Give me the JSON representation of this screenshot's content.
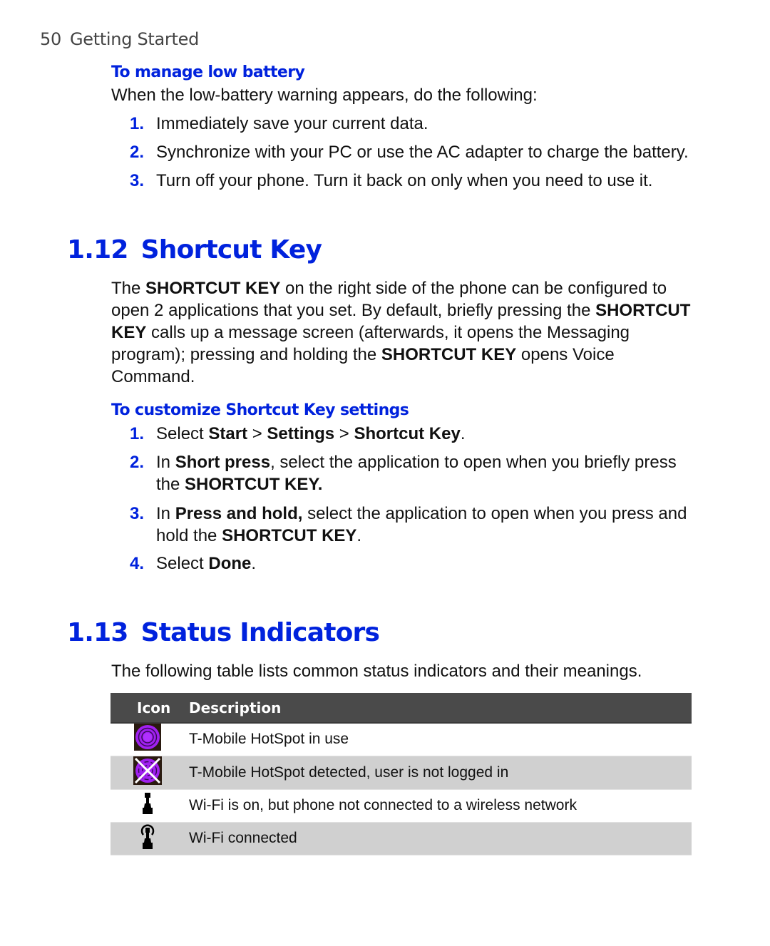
{
  "running_head": {
    "page_number": "50",
    "chapter": "Getting Started"
  },
  "low_battery": {
    "heading": "To manage low battery",
    "intro": "When the low-battery warning appears, do the following:",
    "steps": [
      {
        "num": "1.",
        "text": "Immediately save your current data."
      },
      {
        "num": "2.",
        "text": "Synchronize with your PC or use the AC adapter to charge the battery."
      },
      {
        "num": "3.",
        "text": "Turn off your phone. Turn it back on only when you need to use it."
      }
    ]
  },
  "section_112": {
    "number": "1.12",
    "title": "Shortcut Key",
    "paragraph": [
      {
        "t": "The ",
        "b": false
      },
      {
        "t": "SHORTCUT KEY",
        "b": true
      },
      {
        "t": " on the right side of the phone can be configured to open 2 applications that you set. By default, briefly pressing the ",
        "b": false
      },
      {
        "t": "SHORTCUT KEY",
        "b": true
      },
      {
        "t": " calls up a message screen (afterwards, it opens the Messaging program); pressing and holding the ",
        "b": false
      },
      {
        "t": "SHORTCUT KEY",
        "b": true
      },
      {
        "t": " opens Voice Command.",
        "b": false
      }
    ],
    "sub_heading": "To customize Shortcut Key settings",
    "steps": [
      {
        "num": "1.",
        "parts": [
          {
            "t": "Select ",
            "b": false
          },
          {
            "t": "Start",
            "b": true
          },
          {
            "t": " > ",
            "b": false
          },
          {
            "t": "Settings",
            "b": true
          },
          {
            "t": " > ",
            "b": false
          },
          {
            "t": "Shortcut Key",
            "b": true
          },
          {
            "t": ".",
            "b": false
          }
        ]
      },
      {
        "num": "2.",
        "parts": [
          {
            "t": "In ",
            "b": false
          },
          {
            "t": "Short press",
            "b": true
          },
          {
            "t": ", select the application to open when you briefly press the ",
            "b": false
          },
          {
            "t": "SHORTCUT KEY.",
            "b": true
          }
        ]
      },
      {
        "num": "3.",
        "parts": [
          {
            "t": "In ",
            "b": false
          },
          {
            "t": "Press and hold,",
            "b": true
          },
          {
            "t": " select the application to open when you press and hold the ",
            "b": false
          },
          {
            "t": "SHORTCUT KEY",
            "b": true
          },
          {
            "t": ".",
            "b": false
          }
        ]
      },
      {
        "num": "4.",
        "parts": [
          {
            "t": "Select ",
            "b": false
          },
          {
            "t": "Done",
            "b": true
          },
          {
            "t": ".",
            "b": false
          }
        ]
      }
    ]
  },
  "section_113": {
    "number": "1.13",
    "title": "Status Indicators",
    "intro": "The following table lists common status indicators and their meanings.",
    "table": {
      "headers": {
        "icon": "Icon",
        "description": "Description"
      },
      "rows": [
        {
          "icon": "hotspot-in-use-icon",
          "description": "T-Mobile HotSpot in use"
        },
        {
          "icon": "hotspot-not-logged-in-icon",
          "description": "T-Mobile HotSpot detected, user is not logged in"
        },
        {
          "icon": "wifi-on-not-connected-icon",
          "description": "Wi-Fi is on, but phone not connected to a wireless network"
        },
        {
          "icon": "wifi-connected-icon",
          "description": "Wi-Fi connected"
        }
      ]
    }
  },
  "colors": {
    "accent": "#0022dd",
    "table_header_bg": "#4a4a4a",
    "table_alt_row_bg": "#d0d0d0",
    "hotspot_purple": "#a020f0"
  }
}
